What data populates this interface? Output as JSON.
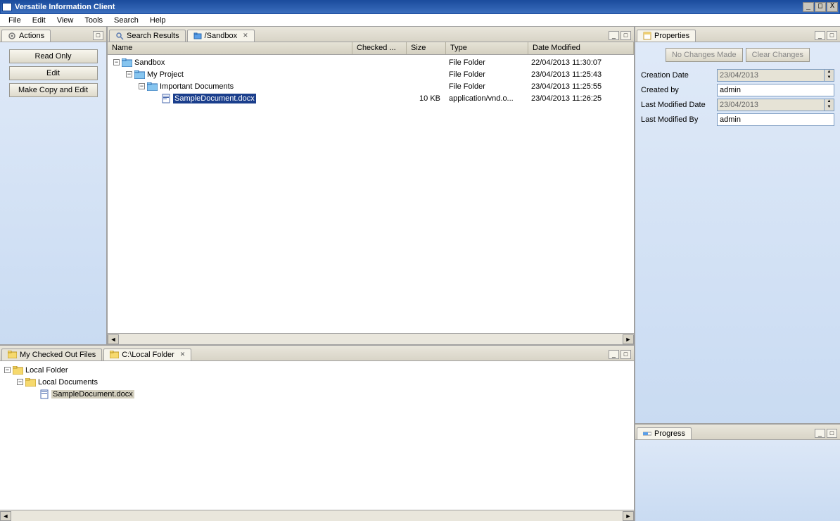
{
  "title": "Versatile Information Client",
  "menu": [
    "File",
    "Edit",
    "View",
    "Tools",
    "Search",
    "Help"
  ],
  "actions_panel": {
    "title": "Actions",
    "buttons": [
      "Read Only",
      "Edit",
      "Make Copy and Edit"
    ]
  },
  "main_tabs": {
    "search_results": "Search Results",
    "sandbox": "/Sandbox"
  },
  "grid_headers": {
    "name": "Name",
    "checked_out": "Checked ...",
    "size": "Size",
    "type": "Type",
    "date_modified": "Date Modified"
  },
  "tree": {
    "sandbox": {
      "name": "Sandbox",
      "type": "File Folder",
      "date": "22/04/2013 11:30:07"
    },
    "myproject": {
      "name": "My Project",
      "type": "File Folder",
      "date": "23/04/2013 11:25:43"
    },
    "important": {
      "name": "Important Documents",
      "type": "File Folder",
      "date": "23/04/2013 11:25:55"
    },
    "sampledoc": {
      "name": "SampleDocument.docx",
      "size": "10 KB",
      "type": "application/vnd.o...",
      "date": "23/04/2013 11:26:25"
    }
  },
  "checked_out_tab": "My Checked Out Files",
  "local_folder_tab": "C:\\Local Folder",
  "local_tree": {
    "root": "Local Folder",
    "docs": "Local Documents",
    "file": "SampleDocument.docx"
  },
  "properties": {
    "title": "Properties",
    "no_changes": "No Changes Made",
    "clear_changes": "Clear Changes",
    "creation_date_label": "Creation Date",
    "creation_date": "23/04/2013",
    "created_by_label": "Created by",
    "created_by": "admin",
    "last_mod_date_label": "Last Modified Date",
    "last_mod_date": "23/04/2013",
    "last_mod_by_label": "Last Modified By",
    "last_mod_by": "admin"
  },
  "progress": {
    "title": "Progress"
  }
}
